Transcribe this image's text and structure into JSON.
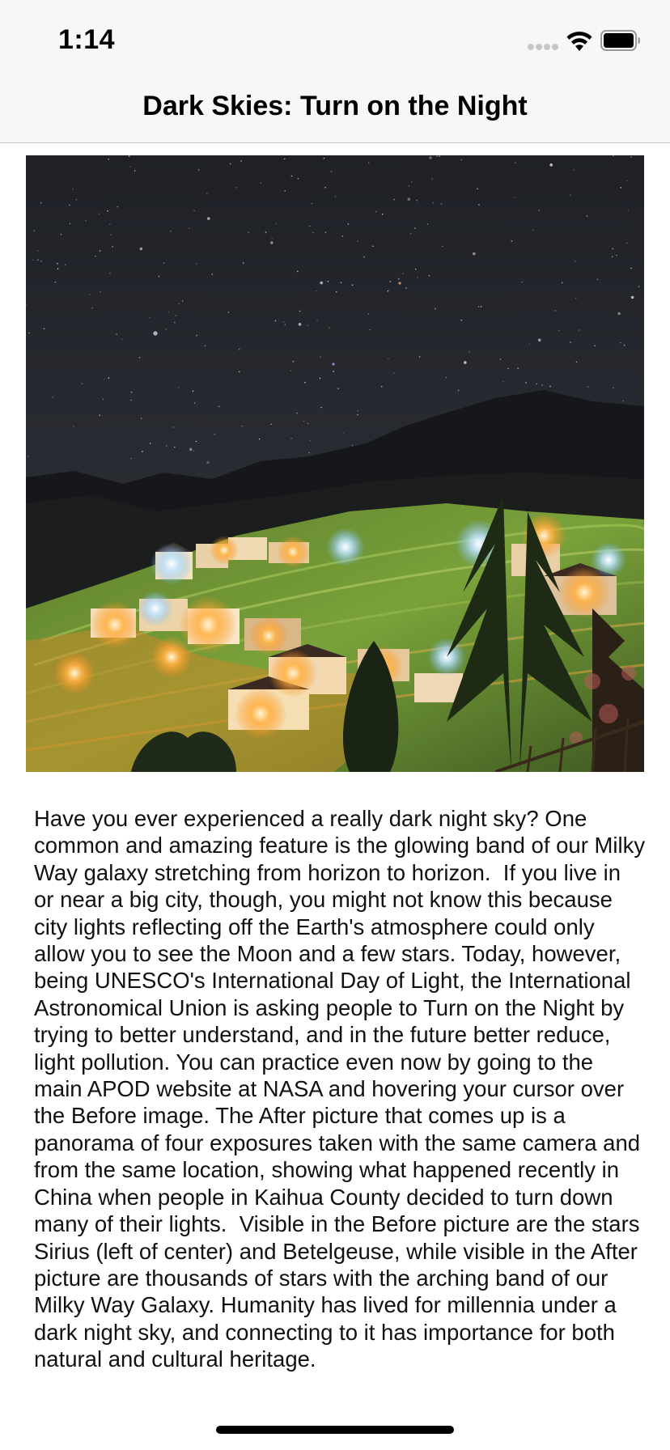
{
  "status_bar": {
    "time": "1:14",
    "icons": [
      "signal-icon",
      "wifi-icon",
      "battery-icon"
    ]
  },
  "nav": {
    "title": "Dark Skies: Turn on the Night"
  },
  "hero_image": {
    "icon": "night-sky-village-photo"
  },
  "article": {
    "text": "Have you ever experienced a really dark night sky? One common and amazing feature is the glowing band of our Milky Way galaxy stretching from horizon to horizon.  If you live in or near a big city, though, you might not know this because city lights reflecting off the Earth's atmosphere could only allow you to see the Moon and a few stars. Today, however, being UNESCO's International Day of Light, the International Astronomical Union is asking people to Turn on the Night by trying to better understand, and in the future better reduce, light pollution. You can practice even now by going to the main APOD website at NASA and hovering your cursor over the Before image. The After picture that comes up is a panorama of four exposures taken with the same camera and from the same location, showing what happened recently in China when people in Kaihua County decided to turn down many of their lights.  Visible in the Before picture are the stars Sirius (left of center) and Betelgeuse, while visible in the After picture are thousands of stars with the arching band of our Milky Way Galaxy. Humanity has lived for millennia under a dark night sky, and connecting to it has importance for both natural and cultural heritage."
  },
  "colors": {
    "bar_background": "#f7f7f7",
    "separator": "#c8c8cc",
    "text": "#111111"
  }
}
